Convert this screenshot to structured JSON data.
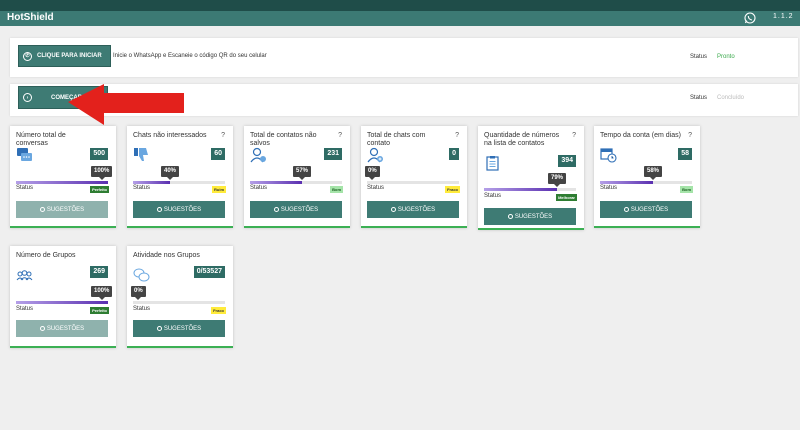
{
  "app": {
    "title": "HotShield",
    "version": "1.1.2"
  },
  "top_panel": {
    "start_button": "CLIQUE PARA INICIAR",
    "instruction": "Inicie o WhatsApp e Escaneie o código QR do seu celular",
    "status_label": "Status",
    "status_value": "Pronto"
  },
  "second_panel": {
    "button": "COMEÇAR",
    "status_label": "Status",
    "status_value": "Concluído"
  },
  "colors": {
    "accent": "#3e7b74",
    "status_green": "#3aa94c",
    "arrow": "#e3211c"
  },
  "cards": [
    {
      "title": "Número total de conversas",
      "help": "",
      "icon": "chat-bubbles-icon",
      "value": "500",
      "percent": 100,
      "percent_label": "100%",
      "status_label": "Status",
      "badge": "Perfeito",
      "badge_type": "green",
      "button": "SUGESTÕES",
      "button_style": "light"
    },
    {
      "title": "Chats não interessados",
      "help": "?",
      "icon": "thumbs-down-icon",
      "value": "60",
      "percent": 40,
      "percent_label": "40%",
      "status_label": "Status",
      "badge": "Ruim",
      "badge_type": "yellow",
      "button": "SUGESTÕES",
      "button_style": "dark"
    },
    {
      "title": "Total de contatos não salvos",
      "help": "?",
      "icon": "user-check-icon",
      "value": "231",
      "percent": 57,
      "percent_label": "57%",
      "status_label": "Status",
      "badge": "Bom",
      "badge_type": "lgreen",
      "button": "SUGESTÕES",
      "button_style": "dark"
    },
    {
      "title": "Total de chats com contato",
      "help": "?",
      "icon": "user-add-icon",
      "value": "0",
      "percent": 0,
      "percent_label": "0%",
      "status_label": "Status",
      "badge": "Fraco",
      "badge_type": "yellow",
      "button": "SUGESTÕES",
      "button_style": "dark"
    },
    {
      "title": "Quantidade de números na lista de contatos",
      "help": "?",
      "icon": "clipboard-list-icon",
      "value": "394",
      "percent": 79,
      "percent_label": "79%",
      "status_label": "Status",
      "badge": "Melhorar",
      "badge_type": "green",
      "button": "SUGESTÕES",
      "button_style": "dark"
    },
    {
      "title": "Tempo da conta (em dias)",
      "help": "?",
      "icon": "calendar-clock-icon",
      "value": "58",
      "percent": 58,
      "percent_label": "58%",
      "status_label": "Status",
      "badge": "Bom",
      "badge_type": "lgreen",
      "button": "SUGESTÕES",
      "button_style": "dark"
    },
    {
      "title": "Número de Grupos",
      "help": "",
      "icon": "group-icon",
      "value": "269",
      "percent": 100,
      "percent_label": "100%",
      "status_label": "Status",
      "badge": "Perfeito",
      "badge_type": "green",
      "button": "SUGESTÕES",
      "button_style": "light"
    },
    {
      "title": "Atividade nos Grupos",
      "help": "",
      "icon": "group-chat-icon",
      "value": "0/53527",
      "percent": 0,
      "percent_label": "0%",
      "status_label": "Status",
      "badge": "Fraco",
      "badge_type": "yellow",
      "button": "SUGESTÕES",
      "button_style": "dark"
    }
  ]
}
